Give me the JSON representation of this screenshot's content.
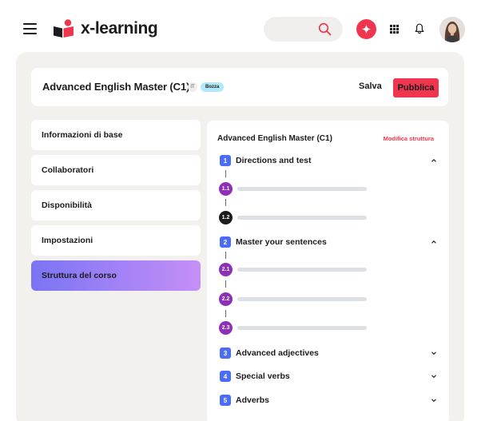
{
  "topbar": {
    "brand": "x-learning",
    "icons": {
      "menu": "hamburger-icon",
      "search": "search-icon",
      "ai": "sparkle-icon",
      "apps": "apps-grid-icon",
      "notifications": "bell-icon"
    },
    "accent_color": "#f0364e"
  },
  "header": {
    "course_title": "Advanced English Master (C1)",
    "language": "IT",
    "status": "Bozza",
    "save_label": "Salva",
    "publish_label": "Pubblica"
  },
  "sidebar": {
    "items": [
      {
        "label": "Informazioni di base",
        "active": false
      },
      {
        "label": "Collaboratori",
        "active": false
      },
      {
        "label": "Disponibilità",
        "active": false
      },
      {
        "label": "Impostazioni",
        "active": false
      },
      {
        "label": "Struttura del corso",
        "active": true
      }
    ]
  },
  "structure": {
    "title": "Advanced English Master (C1)",
    "edit_label": "Modifica struttura",
    "modules": [
      {
        "num": "1",
        "title": "Directions and test",
        "expanded": true,
        "lessons": [
          "1.1",
          "1.2"
        ]
      },
      {
        "num": "2",
        "title": "Master your sentences",
        "expanded": true,
        "lessons": [
          "2.1",
          "2.2",
          "2.3"
        ]
      },
      {
        "num": "3",
        "title": "Advanced adjectives",
        "expanded": false,
        "lessons": []
      },
      {
        "num": "4",
        "title": "Special verbs",
        "expanded": false,
        "lessons": []
      },
      {
        "num": "5",
        "title": "Adverbs",
        "expanded": false,
        "lessons": []
      }
    ]
  }
}
